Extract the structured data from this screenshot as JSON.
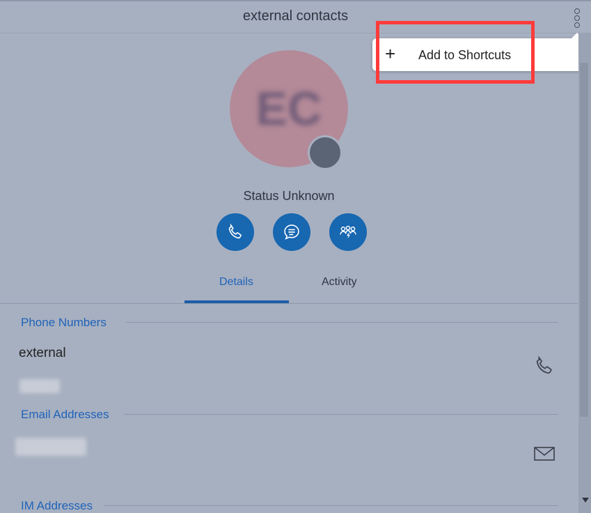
{
  "header": {
    "title": "external contacts"
  },
  "menu": {
    "add_shortcut_label": "Add to Shortcuts",
    "plus_symbol": "+"
  },
  "profile": {
    "initials": "EC",
    "status": "Status Unknown"
  },
  "actions": [
    {
      "icon": "phone-icon",
      "label": "call"
    },
    {
      "icon": "chat-icon",
      "label": "chat"
    },
    {
      "icon": "group-icon",
      "label": "meeting"
    }
  ],
  "tabs": {
    "details": "Details",
    "activity": "Activity"
  },
  "sections": {
    "phone": {
      "title": "Phone Numbers",
      "entry_name": "external"
    },
    "email": {
      "title": "Email Addresses"
    },
    "im": {
      "title": "IM Addresses"
    }
  },
  "colors": {
    "accent": "#1767b1",
    "highlight": "#ff3b3b",
    "background": "#a7b0c1"
  }
}
